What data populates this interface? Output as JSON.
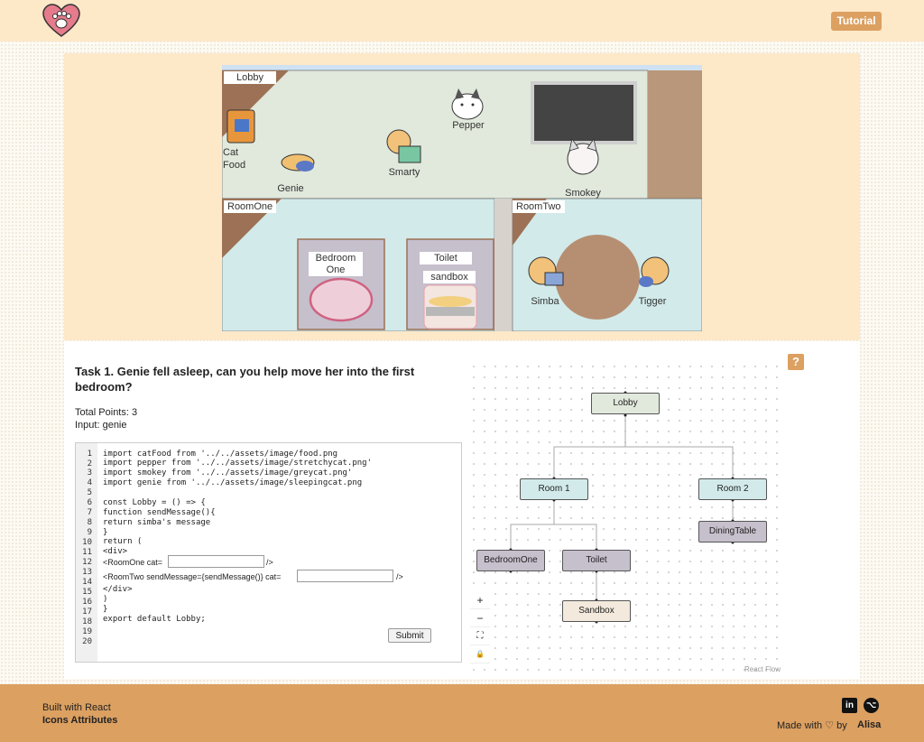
{
  "header": {
    "tutorial_label": "Tutorial",
    "accent_color": "#dca061",
    "logo_icon": "paw-heart-icon"
  },
  "map": {
    "rooms": {
      "lobby": "Lobby",
      "room_one": "RoomOne",
      "room_two": "RoomTwo"
    },
    "furniture": {
      "cat_food_line1": "Cat",
      "cat_food_line2": "Food",
      "bedroom_line1": "Bedroom",
      "bedroom_line2": "One",
      "toilet": "Toilet",
      "sandbox": "sandbox"
    },
    "cats": {
      "pepper": "Pepper",
      "genie": "Genie",
      "smarty": "Smarty",
      "smokey": "Smokey",
      "simba": "Simba",
      "tigger": "Tigger"
    }
  },
  "task": {
    "title": "Task 1. Genie fell asleep, can you help move her into the first bedroom?",
    "points": "Total Points: 3",
    "input": "Input: genie"
  },
  "editor": {
    "line_numbers": [
      "1",
      "2",
      "3",
      "4",
      "5",
      "6",
      "7",
      "8",
      "9",
      "10",
      "11",
      "12",
      "13",
      "14",
      "15",
      "16",
      "17",
      "18",
      "19",
      "20"
    ],
    "lines": {
      "l1": "import catFood from '../../assets/image/food.png",
      "l2": "import pepper from '../../assets/image/stretchycat.png'",
      "l3": "import smokey from '../../assets/image/greycat.png'",
      "l4": "import genie from '../../assets/image/sleepingcat.png",
      "l6": "const Lobby = () => {",
      "l7": "function sendMessage(){",
      "l8": "return simba's message",
      "l9": "}",
      "l10": "return (",
      "l11": "<div>",
      "l12_prefix": "<RoomOne cat=",
      "l12_suffix": "/>",
      "l13_prefix": "<RoomTwo sendMessage={sendMessage()} cat=",
      "l13_suffix": "/>",
      "l15": "</div>",
      "l16": ")",
      "l17": "}",
      "l18": "export default Lobby;"
    },
    "room_one_cat_value": "",
    "room_two_cat_value": "",
    "submit_label": "Submit"
  },
  "flow": {
    "nodes": {
      "lobby": "Lobby",
      "room1": "Room 1",
      "room2": "Room 2",
      "bedroom_one": "BedroomOne",
      "toilet": "Toilet",
      "dining_table": "DiningTable",
      "sandbox": "Sandbox"
    },
    "controls": {
      "zoom_in": "+",
      "zoom_out": "−",
      "fit_view": "⛶",
      "lock": "🔒"
    },
    "attribution": "React Flow",
    "help_label": "?"
  },
  "footer": {
    "built_with": "Built with React",
    "icons_attr": "Icons Attributes",
    "made_with": "Made with ♡ by",
    "author": "Alisa",
    "linkedin_label": "in",
    "github_label": "⌥"
  }
}
